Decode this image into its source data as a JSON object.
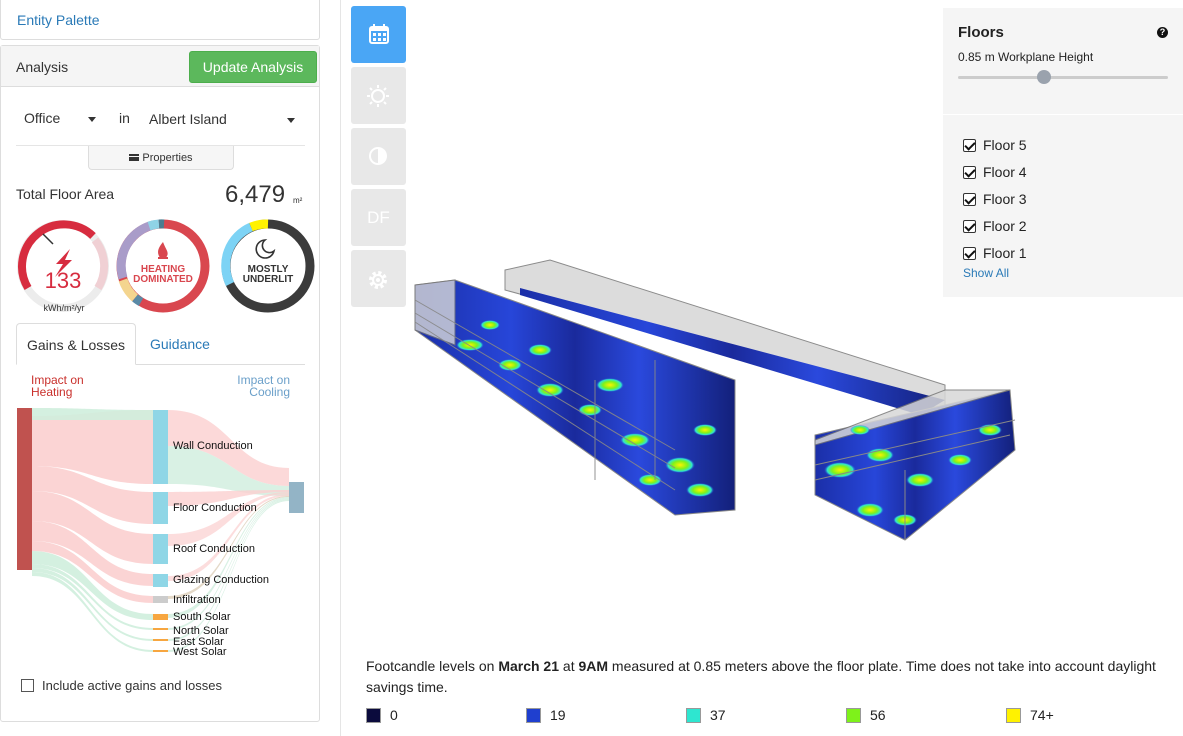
{
  "entity_palette": {
    "label": "Entity Palette"
  },
  "analysis": {
    "title": "Analysis",
    "update_button": "Update Analysis",
    "building_type": "Office",
    "in_label": "in",
    "location": "Albert Island",
    "properties_button": "Properties",
    "total_floor_area_label": "Total Floor Area",
    "total_floor_area_value": "6,479",
    "total_floor_area_unit": "m²",
    "gauges": {
      "eui_value": "133",
      "eui_unit": "kWh/m²/yr",
      "heating_line1": "HEATING",
      "heating_line2": "DOMINATED",
      "lit_line1": "MOSTLY",
      "lit_line2": "UNDERLIT"
    },
    "tabs": {
      "gains": "Gains & Losses",
      "guidance": "Guidance"
    },
    "impact_heating": [
      "Impact on",
      "Heating"
    ],
    "impact_cooling": [
      "Impact on",
      "Cooling"
    ],
    "sankey_labels": [
      "Wall Conduction",
      "Floor Conduction",
      "Roof Conduction",
      "Glazing Conduction",
      "Infiltration",
      "South Solar",
      "North Solar",
      "East Solar",
      "West Solar"
    ],
    "include_active": "Include active gains and losses"
  },
  "toolbar": {
    "df_label": "DF"
  },
  "floors": {
    "title": "Floors",
    "workplane": "0.85 m Workplane Height",
    "items": [
      "Floor 5",
      "Floor 4",
      "Floor 3",
      "Floor 2",
      "Floor 1"
    ],
    "show_all": "Show All"
  },
  "caption": {
    "p1": "Footcandle levels on ",
    "date": "March 21",
    "p2": " at ",
    "time": "9AM",
    "p3": " measured at 0.85 meters above the floor plate. Time does not take into account daylight savings time."
  },
  "legend": [
    {
      "label": "0",
      "color": "#0b0b3d"
    },
    {
      "label": "19",
      "color": "#1f3fcf"
    },
    {
      "label": "37",
      "color": "#2ee6d0"
    },
    {
      "label": "56",
      "color": "#7ef21a"
    },
    {
      "label": "74+",
      "color": "#fff200"
    }
  ]
}
